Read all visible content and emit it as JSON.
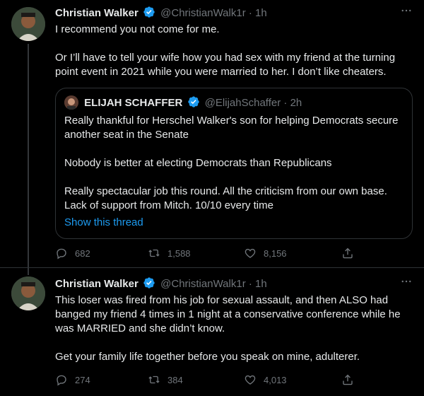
{
  "tweets": [
    {
      "name": "Christian Walker",
      "handle": "@ChristianWalk1r",
      "dot": "·",
      "time": "1h",
      "text": "I recommend you not come for me.\n\nOr I’ll have to tell your wife how you had sex with my friend at the turning point event in 2021 while you were married to her. I don’t like cheaters.",
      "quote": {
        "name": "ELIJAH SCHAFFER",
        "handle": "@ElijahSchaffer",
        "dot": "·",
        "time": "2h",
        "text": "Really thankful for Herschel Walker's son for helping Democrats secure another seat in the Senate\n\nNobody is better at electing Democrats than Republicans\n\nReally spectacular job this round. All the criticism from our own base. Lack of support from Mitch. 10/10 every time",
        "show_thread": "Show this thread"
      },
      "stats": {
        "replies": "682",
        "retweets": "1,588",
        "likes": "8,156"
      }
    },
    {
      "name": "Christian Walker",
      "handle": "@ChristianWalk1r",
      "dot": "·",
      "time": "1h",
      "text": "This loser was fired from his job for sexual assault, and then ALSO had banged my friend 4 times in 1 night at a conservative conference while he was MARRIED and she didn’t know.\n\nGet your family life together before you speak on mine, adulterer.",
      "stats": {
        "replies": "274",
        "retweets": "384",
        "likes": "4,013"
      }
    }
  ],
  "colors": {
    "background": "#000000",
    "text": "#e7e9ea",
    "muted": "#71767b",
    "accent": "#1d9bf0",
    "border": "#2f3336"
  },
  "icons": [
    "more-icon",
    "verified-badge-icon",
    "reply-icon",
    "retweet-icon",
    "like-icon",
    "share-icon"
  ]
}
